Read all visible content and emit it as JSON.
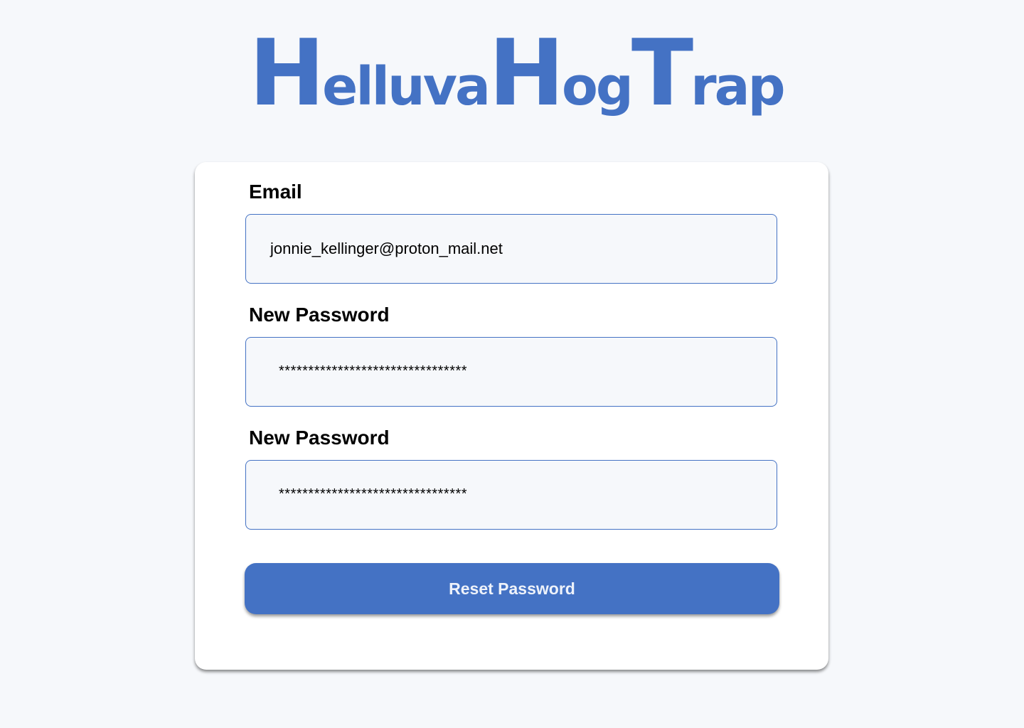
{
  "brand": {
    "logo_parts": [
      "H",
      "elluva",
      "H",
      "og",
      "T",
      "rap"
    ],
    "color": "#4472c4"
  },
  "form": {
    "email": {
      "label": "Email",
      "value": "jonnie_kellinger@proton_mail.net"
    },
    "new_password": {
      "label": "New Password",
      "value": "********************************"
    },
    "confirm_password": {
      "label": "New Password",
      "value": "********************************"
    },
    "submit_label": "Reset Password"
  },
  "colors": {
    "accent": "#4472c4",
    "page_background": "#f6f8fb",
    "card_background": "#ffffff"
  }
}
